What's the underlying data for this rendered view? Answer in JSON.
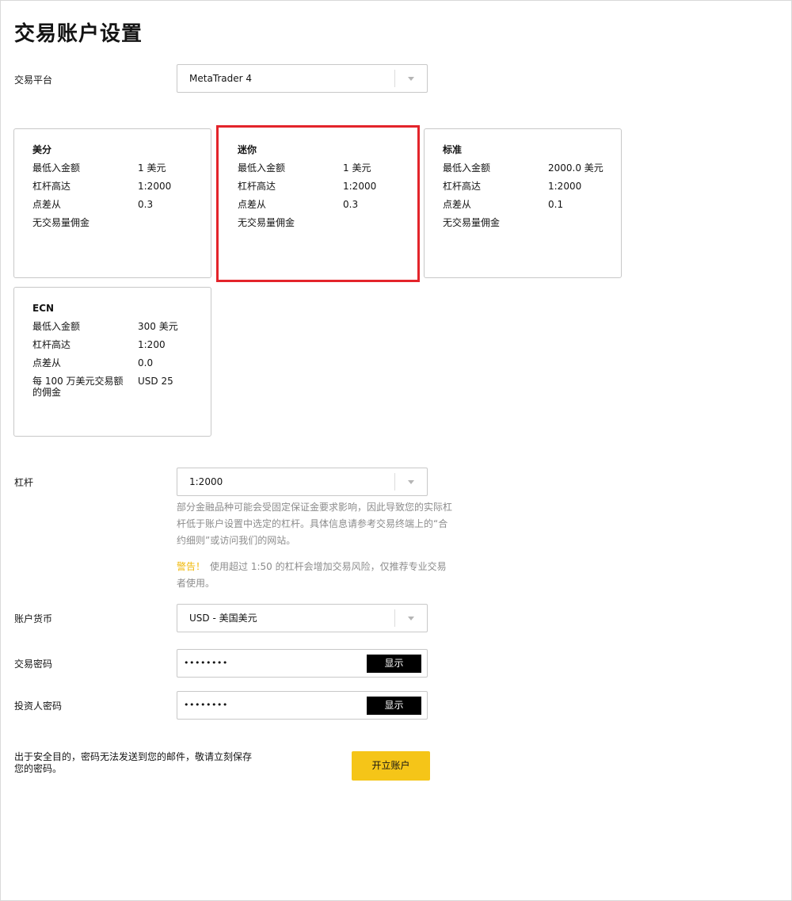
{
  "page": {
    "title": "交易账户设置"
  },
  "platform": {
    "label": "交易平台",
    "value": "MetaTrader 4"
  },
  "account_types": [
    {
      "name": "美分",
      "rows": [
        {
          "key": "最低入金额",
          "value": "1 美元"
        },
        {
          "key": "杠杆高达",
          "value": "1:2000"
        },
        {
          "key": "点差从",
          "value": "0.3"
        }
      ],
      "note": "无交易量佣金"
    },
    {
      "name": "迷你",
      "rows": [
        {
          "key": "最低入金额",
          "value": "1 美元"
        },
        {
          "key": "杠杆高达",
          "value": "1:2000"
        },
        {
          "key": "点差从",
          "value": "0.3"
        }
      ],
      "note": "无交易量佣金"
    },
    {
      "name": "标准",
      "rows": [
        {
          "key": "最低入金额",
          "value": "2000.0 美元"
        },
        {
          "key": "杠杆高达",
          "value": "1:2000"
        },
        {
          "key": "点差从",
          "value": "0.1"
        }
      ],
      "note": "无交易量佣金"
    },
    {
      "name": "ECN",
      "rows": [
        {
          "key": "最低入金额",
          "value": "300 美元"
        },
        {
          "key": "杠杆高达",
          "value": "1:200"
        },
        {
          "key": "点差从",
          "value": "0.0"
        },
        {
          "key": "每 100 万美元交易额的佣金",
          "value": "USD 25"
        }
      ],
      "note": ""
    }
  ],
  "leverage": {
    "label": "杠杆",
    "value": "1:2000",
    "help": "部分金融品种可能会受固定保证金要求影响，因此导致您的实际杠杆低于账户设置中选定的杠杆。具体信息请参考交易终端上的“合约细则”或访问我们的网站。",
    "warning_label": "警告！",
    "warning_text": "使用超过 1:50 的杠杆会增加交易风险，仅推荐专业交易者使用。"
  },
  "currency": {
    "label": "账户货币",
    "value": "USD - 美国美元"
  },
  "trading_password": {
    "label": "交易密码",
    "value": "••••••••",
    "show_label": "显示"
  },
  "investor_password": {
    "label": "投资人密码",
    "value": "••••••••",
    "show_label": "显示"
  },
  "footer": {
    "security_note": "出于安全目的，密码无法发送到您的邮件，敬请立刻保存您的密码。",
    "open_account_label": "开立账户"
  },
  "colors": {
    "highlight_border": "#e3242b",
    "accent_yellow": "#f5c518",
    "warning_text": "#f0b90b"
  }
}
